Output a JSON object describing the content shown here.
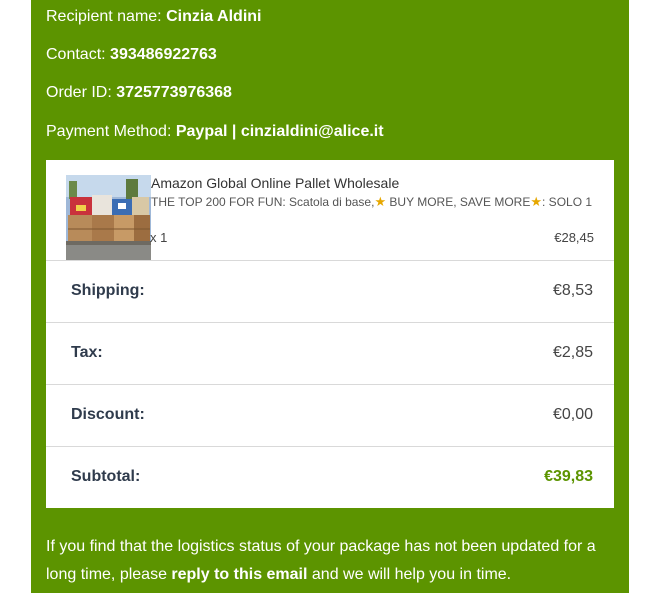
{
  "colors": {
    "accent_green": "#5c9400",
    "total_green": "#5c9400"
  },
  "order_info": {
    "recipient_label": "Recipient name:",
    "recipient_value": "Cinzia Aldini",
    "contact_label": "Contact:",
    "contact_value": "393486922763",
    "order_id_label": "Order ID:",
    "order_id_value": "3725773976368",
    "payment_label": "Payment Method:",
    "payment_value": "Paypal | cinzialdini@alice.it"
  },
  "product": {
    "image_icon": "product-pallet-photo",
    "title": "Amazon Global Online Pallet Wholesale",
    "desc_part1": "THE TOP 200 FOR FUN: Scatola di base,",
    "desc_part2": " BUY MORE, SAVE MORE",
    "desc_part3": ": SOLO 1",
    "star_icon": "star-icon",
    "quantity": "x 1",
    "price": "€28,45"
  },
  "summary": {
    "shipping_label": "Shipping:",
    "shipping_value": "€8,53",
    "tax_label": "Tax:",
    "tax_value": "€2,85",
    "discount_label": "Discount:",
    "discount_value": "€0,00",
    "subtotal_label": "Subtotal:",
    "subtotal_value": "€39,83"
  },
  "footer": {
    "text_before": "If you find that the logistics status of your package has not been updated for a long time, please ",
    "link_text": "reply to this email",
    "text_after": " and we will help you in time."
  }
}
